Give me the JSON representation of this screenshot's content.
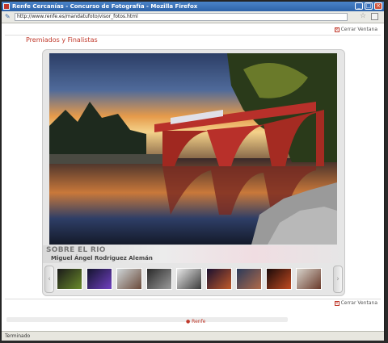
{
  "window": {
    "title": "Renfe Cercanías - Concurso de Fotografía - Mozilla Firefox"
  },
  "urlbar": {
    "url": "http://www.renfe.es/mandatufoto/visor_fotos.html"
  },
  "page": {
    "close_label": "Cerrar Ventana",
    "title": "Premiados y Finalistas",
    "photo_title": "SOBRE EL RIO",
    "photo_author": "Miguel Ángel Rodriguez Alemán",
    "footer_link": "Renfe"
  },
  "thumbnails": [
    {
      "id": "t1",
      "colors": [
        "#1a1a1a",
        "#6a8a2a"
      ]
    },
    {
      "id": "t2",
      "colors": [
        "#14142e",
        "#7040c0"
      ]
    },
    {
      "id": "t3",
      "colors": [
        "#cfd6d8",
        "#6a4a3a"
      ]
    },
    {
      "id": "t4",
      "colors": [
        "#2a2a2a",
        "#9a9a9a"
      ]
    },
    {
      "id": "t5",
      "colors": [
        "#e8e8e8",
        "#3a3a3a"
      ]
    },
    {
      "id": "t6",
      "colors": [
        "#1a1030",
        "#c05a2a"
      ]
    },
    {
      "id": "t7",
      "colors": [
        "#2a3a5a",
        "#b06a4a"
      ]
    },
    {
      "id": "t8",
      "colors": [
        "#1a0a0a",
        "#c04a20"
      ]
    },
    {
      "id": "t9",
      "colors": [
        "#d8d4cc",
        "#6a3a2a"
      ]
    }
  ],
  "status": {
    "text": "Terminado"
  },
  "colors": {
    "accent": "#c0392b",
    "titlebar": "#2e63a8"
  }
}
